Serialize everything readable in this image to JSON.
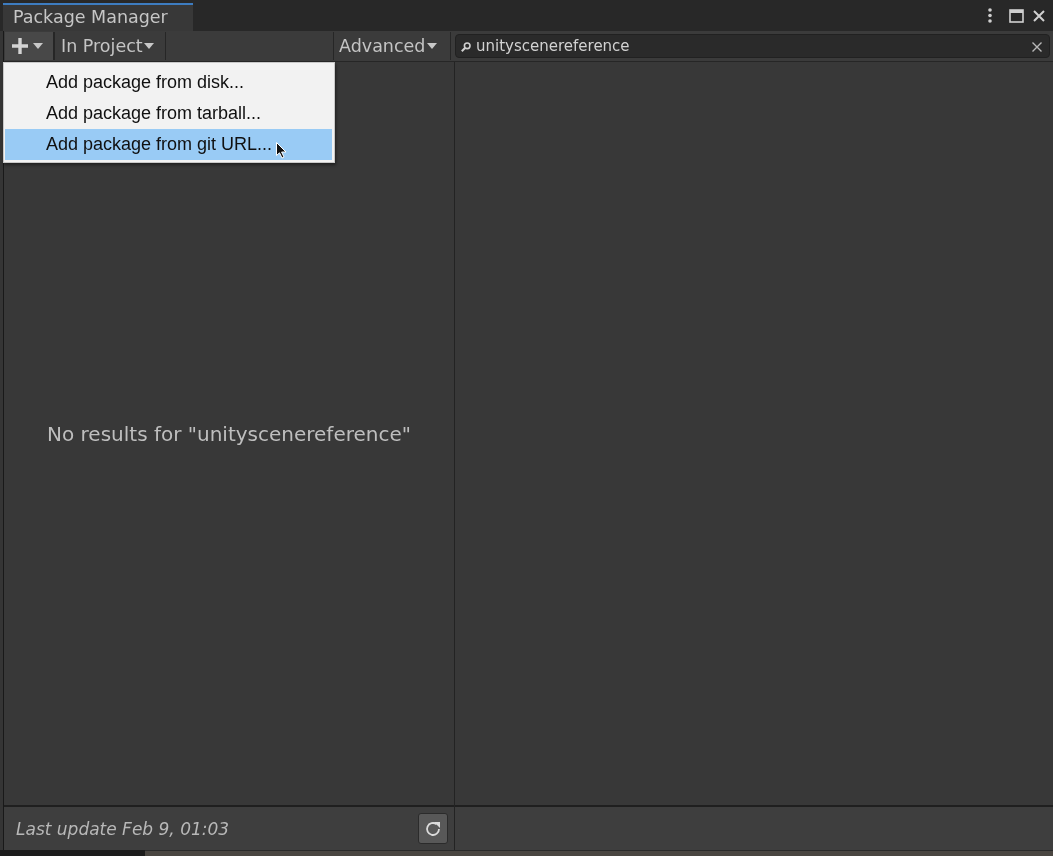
{
  "tabs": [
    {
      "label": "Package Manager",
      "selected": true
    }
  ],
  "toolbar": {
    "add_button": {
      "expanded": true,
      "menu_items": [
        {
          "label": "Add package from disk...",
          "selected": false
        },
        {
          "label": "Add package from tarball...",
          "selected": false
        },
        {
          "label": "Add package from git URL...",
          "selected": true
        }
      ]
    },
    "filter_dropdown": {
      "label": "In Project"
    },
    "advanced_dropdown": {
      "label": "Advanced"
    },
    "search": {
      "value": "unityscenereference"
    }
  },
  "package_list": {
    "empty_message": "No results for \"unityscenereference\""
  },
  "status_bar": {
    "last_update": "Last update Feb 9, 01:03"
  }
}
